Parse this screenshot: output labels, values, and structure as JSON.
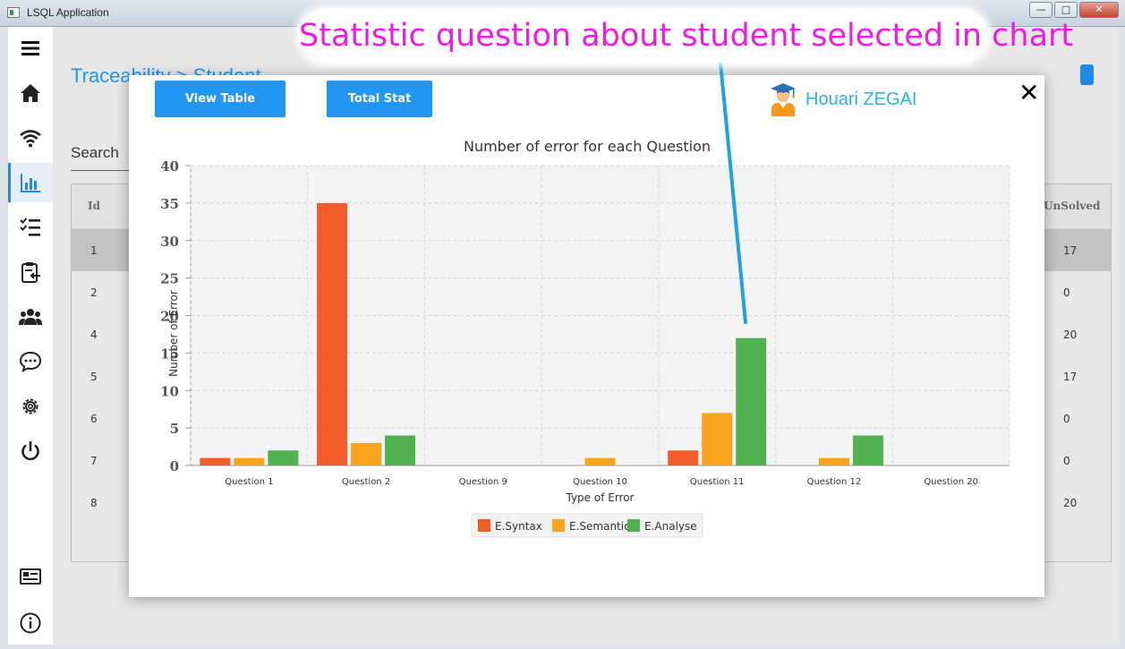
{
  "window": {
    "title": "LSQL Application",
    "min": "—",
    "max": "□",
    "close": "✕"
  },
  "sidebar": {
    "items": [
      {
        "icon": "menu-icon"
      },
      {
        "icon": "home-icon"
      },
      {
        "icon": "wifi-icon"
      },
      {
        "icon": "bar-chart-icon"
      },
      {
        "icon": "checklist-icon"
      },
      {
        "icon": "clipboard-icon"
      },
      {
        "icon": "group-icon"
      },
      {
        "icon": "chat-icon"
      },
      {
        "icon": "gear-icon"
      },
      {
        "icon": "power-icon"
      },
      {
        "icon": "card-icon"
      },
      {
        "icon": "info-icon"
      }
    ]
  },
  "main": {
    "breadcrumb": "Traceability > Student",
    "search_label": "Search",
    "table": {
      "columns": [
        "Id",
        "UnSolved"
      ],
      "rows": [
        {
          "id": "1",
          "unsolved": "17"
        },
        {
          "id": "2",
          "unsolved": "0"
        },
        {
          "id": "4",
          "unsolved": "20"
        },
        {
          "id": "5",
          "unsolved": "17"
        },
        {
          "id": "6",
          "unsolved": "0"
        },
        {
          "id": "7",
          "unsolved": "0"
        },
        {
          "id": "8",
          "unsolved": "20"
        }
      ]
    }
  },
  "modal": {
    "view_table": "View Table",
    "total_stat": "Total Stat",
    "student_name": "Houari ZEGAI",
    "close": "✕"
  },
  "annotation": "Statistic question about student selected in chart",
  "colors": {
    "syntax": "#f15d2a",
    "semantic": "#f6a41d",
    "analyse": "#52b252",
    "accent": "#2196f3",
    "annotation": "#ee1be0"
  },
  "chart_data": {
    "type": "bar",
    "title": "Number of error for each Question",
    "xlabel": "Type of Error",
    "ylabel": "Number of Error",
    "ylim": [
      0,
      40
    ],
    "yticks": [
      0,
      5,
      10,
      15,
      20,
      25,
      30,
      35,
      40
    ],
    "categories": [
      "Question 1",
      "Question 2",
      "Question 9",
      "Question 10",
      "Question 11",
      "Question 12",
      "Question 20"
    ],
    "series": [
      {
        "name": "E.Syntax",
        "values": [
          1,
          35,
          0,
          0,
          2,
          0,
          0
        ]
      },
      {
        "name": "E.Semantic",
        "values": [
          1,
          3,
          0,
          1,
          7,
          1,
          0
        ]
      },
      {
        "name": "E.Analyse",
        "values": [
          2,
          4,
          0,
          0,
          17,
          4,
          0
        ]
      }
    ],
    "legend": "bottom",
    "grid": true
  }
}
